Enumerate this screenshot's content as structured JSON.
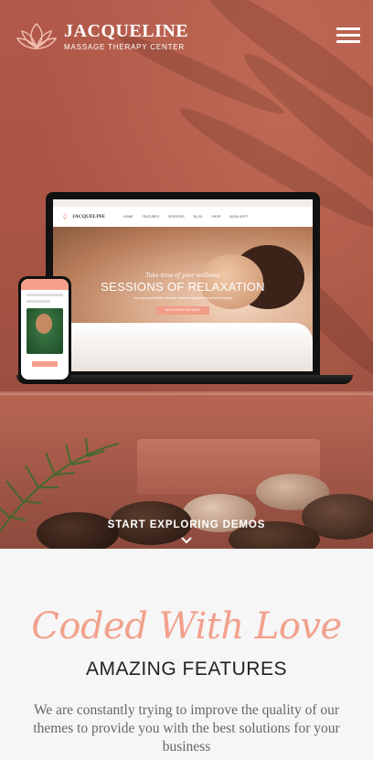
{
  "header": {
    "logo_title": "JACQUELINE",
    "logo_subtitle": "MASSAGE THERAPY CENTER",
    "menu_icon": "hamburger-menu-icon"
  },
  "hero": {
    "cta_label": "START EXPLORING DEMOS",
    "cta_icon": "chevron-down-icon",
    "laptop_screen": {
      "script_text": "Take time of your wellness",
      "title": "SESSIONS OF RELAXATION",
      "tagline": "You owe yourself this moment, make an appointment to find a change",
      "button": "BOOK AN APPOINTMENT",
      "logo": "JACQUELINE",
      "menu": [
        "HOME",
        "FEATURES",
        "SERVICES",
        "BLOG",
        "SHOP",
        "BOOK APPT"
      ]
    }
  },
  "features": {
    "script_heading": "Coded With Love",
    "title": "AMAZING FEATURES",
    "description": "We are constantly trying to improve the quality of our themes to provide you with the best solutions for your business"
  },
  "colors": {
    "accent": "#f2a18d",
    "hero_bg": "#a85444",
    "text_dark": "#222222",
    "text_muted": "#666666"
  }
}
